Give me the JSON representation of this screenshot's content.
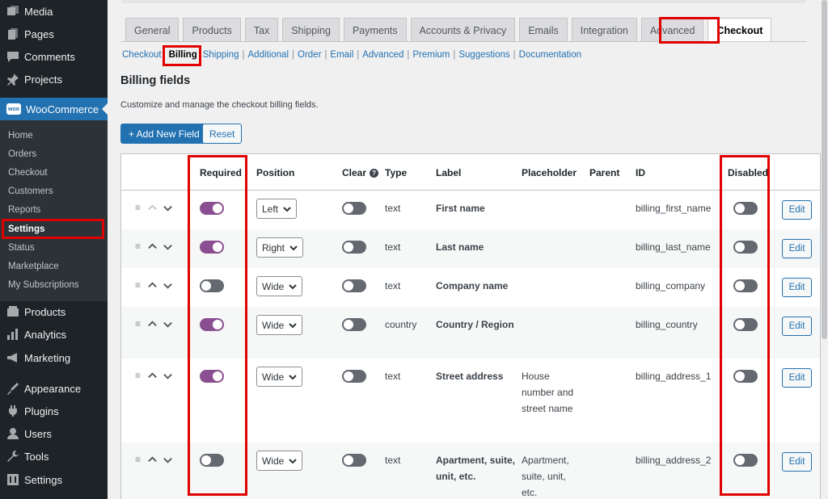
{
  "sidebar": {
    "top_items": [
      {
        "label": "Media",
        "icon": "media-icon"
      },
      {
        "label": "Pages",
        "icon": "pages-icon"
      },
      {
        "label": "Comments",
        "icon": "comments-icon"
      },
      {
        "label": "Projects",
        "icon": "pin-icon"
      }
    ],
    "woocommerce": {
      "label": "WooCommerce",
      "logo": "woo"
    },
    "submenu": [
      "Home",
      "Orders",
      "Checkout",
      "Customers",
      "Reports",
      "Settings",
      "Status",
      "Marketplace",
      "My Subscriptions"
    ],
    "bottom_items": [
      {
        "label": "Products",
        "icon": "products-icon"
      },
      {
        "label": "Analytics",
        "icon": "analytics-icon"
      },
      {
        "label": "Marketing",
        "icon": "marketing-icon"
      },
      {
        "label": "Appearance",
        "icon": "appearance-icon"
      },
      {
        "label": "Plugins",
        "icon": "plugins-icon"
      },
      {
        "label": "Users",
        "icon": "users-icon"
      },
      {
        "label": "Tools",
        "icon": "tools-icon"
      },
      {
        "label": "Settings",
        "icon": "settings-icon"
      }
    ]
  },
  "tabs": [
    "General",
    "Products",
    "Tax",
    "Shipping",
    "Payments",
    "Accounts & Privacy",
    "Emails",
    "Integration",
    "Advanced",
    "Checkout"
  ],
  "active_tab": "Checkout",
  "subnav": [
    "Checkout",
    "Billing",
    "Shipping",
    "Additional",
    "Order",
    "Email",
    "Advanced",
    "Premium",
    "Suggestions",
    "Documentation"
  ],
  "active_subnav": "Billing",
  "section": {
    "title": "Billing fields",
    "description": "Customize and manage the checkout billing fields."
  },
  "buttons": {
    "add_new": "+ Add New Field",
    "reset": "Reset"
  },
  "table": {
    "headers": {
      "required": "Required",
      "position": "Position",
      "clear": "Clear",
      "type": "Type",
      "label": "Label",
      "placeholder": "Placeholder",
      "parent": "Parent",
      "id": "ID",
      "disabled": "Disabled"
    },
    "help_glyph": "?",
    "drag_glyph": "≡",
    "edit_label": "Edit",
    "rows": [
      {
        "required": true,
        "position": "Left",
        "clear": false,
        "type": "text",
        "label": "First name",
        "placeholder": "",
        "id": "billing_first_name",
        "disabled": false,
        "first": true
      },
      {
        "required": true,
        "position": "Right",
        "clear": false,
        "type": "text",
        "label": "Last name",
        "placeholder": "",
        "id": "billing_last_name",
        "disabled": false
      },
      {
        "required": false,
        "position": "Wide",
        "clear": false,
        "type": "text",
        "label": "Company name",
        "placeholder": "",
        "id": "billing_company",
        "disabled": false
      },
      {
        "required": true,
        "position": "Wide",
        "clear": false,
        "type": "country",
        "label": "Country / Region",
        "placeholder": "",
        "id": "billing_country",
        "disabled": false
      },
      {
        "required": true,
        "position": "Wide",
        "clear": false,
        "type": "text",
        "label": "Street address",
        "placeholder": "House number and street name",
        "id": "billing_address_1",
        "disabled": false
      },
      {
        "required": false,
        "position": "Wide",
        "clear": false,
        "type": "text",
        "label": "Apartment, suite, unit, etc.",
        "placeholder": "Apartment, suite, unit, etc.",
        "id": "billing_address_2",
        "disabled": false
      }
    ]
  },
  "colors": {
    "accent": "#2271b1",
    "toggle_on": "#8a4f91",
    "highlight": "#e00000",
    "sidebar_bg": "#1d2327"
  }
}
